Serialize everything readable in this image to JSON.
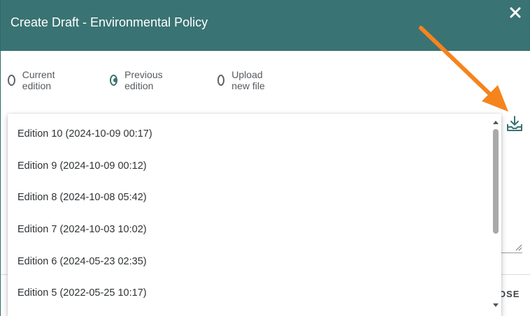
{
  "dialog": {
    "title": "Create Draft - Environmental Policy",
    "close_icon": "close-icon"
  },
  "source_options": [
    {
      "label": "Current edition",
      "selected": false
    },
    {
      "label": "Previous edition",
      "selected": true
    },
    {
      "label": "Upload new file",
      "selected": false
    }
  ],
  "download_icon": "download-tray-icon",
  "editions": [
    "Edition 10 (2024-10-09 00:17)",
    "Edition 9 (2024-10-09 00:12)",
    "Edition 8 (2024-10-08 05:42)",
    "Edition 7 (2024-10-03 10:02)",
    "Edition 6 (2024-05-23 02:35)",
    "Edition 5 (2022-05-25 10:17)"
  ],
  "footer": {
    "close_label": "OSE"
  },
  "colors": {
    "header": "#3a7373",
    "annotation_arrow": "#f5841f"
  }
}
